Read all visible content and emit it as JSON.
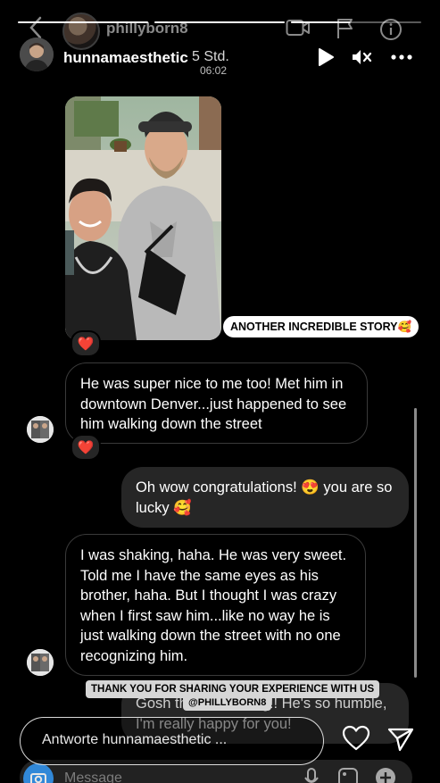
{
  "dm_header": {
    "username": "phillyborn8",
    "icons": [
      "back-chevron-icon",
      "video-call-icon",
      "flag-icon",
      "info-icon"
    ]
  },
  "story": {
    "progress": [
      1,
      1,
      0.45
    ],
    "username": "hunnamaesthetic",
    "age": "5 Std.",
    "sub_time": "06:02",
    "play_icon": "play-icon",
    "mute_icon": "speaker-muted-icon",
    "more_icon": "more-dots-icon",
    "caption_sticker": "ANOTHER INCREDIBLE STORY🥰",
    "share_sticker": "THANK YOU FOR SHARING YOUR EXPERIENCE WITH US",
    "mention_sticker": "@PHILLYBORN8"
  },
  "messages": [
    {
      "from": "other",
      "text": "He was super nice to me too! Met him in downtown Denver...just happened to see him walking down the street",
      "reaction": "❤️"
    },
    {
      "from": "me",
      "text": "Oh wow congratulations! 😍 you are so lucky 🥰"
    },
    {
      "from": "other",
      "text": "I was shaking, haha. He was very sweet. Told me I have the same eyes as his brother, haha. But I thought I was crazy when I first saw him...like no way he is just walking down the street with no one recognizing him."
    },
    {
      "from": "me",
      "text": "Gosh that's amazing!! He's so humble, I'm really happy for you!"
    }
  ],
  "photo_reaction": "❤️",
  "reply": {
    "placeholder": "Antworte hunnamaesthetic ...",
    "heart_icon": "heart-outline-icon",
    "send_icon": "send-paper-plane-icon"
  },
  "composer": {
    "placeholder": "Message",
    "icons": [
      "camera-icon",
      "microphone-icon",
      "image-icon",
      "plus-icon"
    ]
  }
}
